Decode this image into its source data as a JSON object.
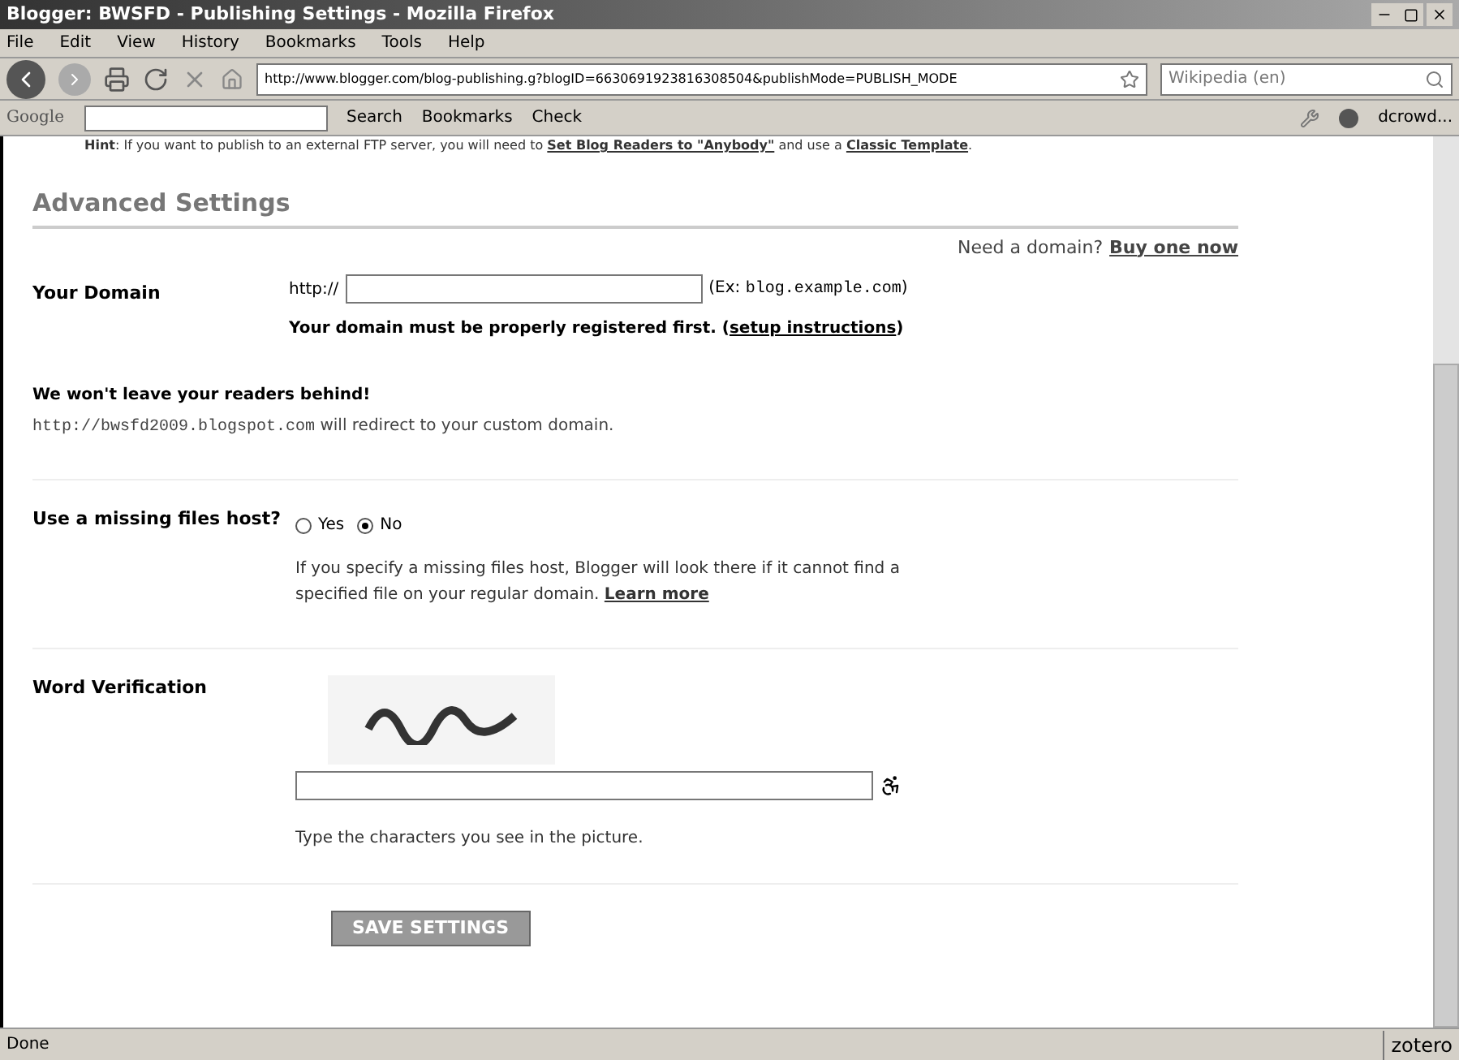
{
  "window": {
    "title": "Blogger: BWSFD - Publishing Settings - Mozilla Firefox"
  },
  "menu": [
    "File",
    "Edit",
    "View",
    "History",
    "Bookmarks",
    "Tools",
    "Help"
  ],
  "address_bar": {
    "value": "http://www.blogger.com/blog-publishing.g?blogID=6630691923816308504&publishMode=PUBLISH_MODE"
  },
  "search_engine": {
    "placeholder": "Wikipedia (en)"
  },
  "google_toolbar": {
    "logo": "Google",
    "items": [
      {
        "label": "Search"
      },
      {
        "label": "Bookmarks"
      },
      {
        "label": "Check"
      }
    ],
    "user": "dcrowd..."
  },
  "hint": {
    "label": "Hint",
    "text": ": If you want to publish to an external FTP server, you will need to ",
    "link1": "Set Blog Readers to \"Anybody\"",
    "middle": " and use a ",
    "link2": "Classic Template",
    "end": "."
  },
  "section_title": "Advanced Settings",
  "domain_promo": {
    "text": "Need a domain?",
    "link": "Buy one now"
  },
  "your_domain": {
    "label": "Your Domain",
    "prefix": "http://",
    "example_label": "(Ex: ",
    "example_code": "blog.example.com",
    "example_end": ")",
    "note": "Your domain must be properly registered first. (",
    "note_link": "setup instructions",
    "note_end": ")"
  },
  "readers": {
    "title": "We won't leave your readers behind!",
    "url": "http://bwsfd2009.blogspot.com",
    "text": " will redirect to your custom domain."
  },
  "missing_host": {
    "label": "Use a missing files host?",
    "options": [
      {
        "label": "Yes",
        "selected": false
      },
      {
        "label": "No",
        "selected": true
      }
    ],
    "help": "If you specify a missing files host, Blogger will look there if it cannot find a specified file on your regular domain.",
    "link": "Learn more"
  },
  "word_verification": {
    "label": "Word Verification",
    "help": "Type the characters you see in the picture."
  },
  "save_button": "SAVE SETTINGS",
  "status_bar": {
    "text": "Done",
    "addon": "zotero"
  }
}
